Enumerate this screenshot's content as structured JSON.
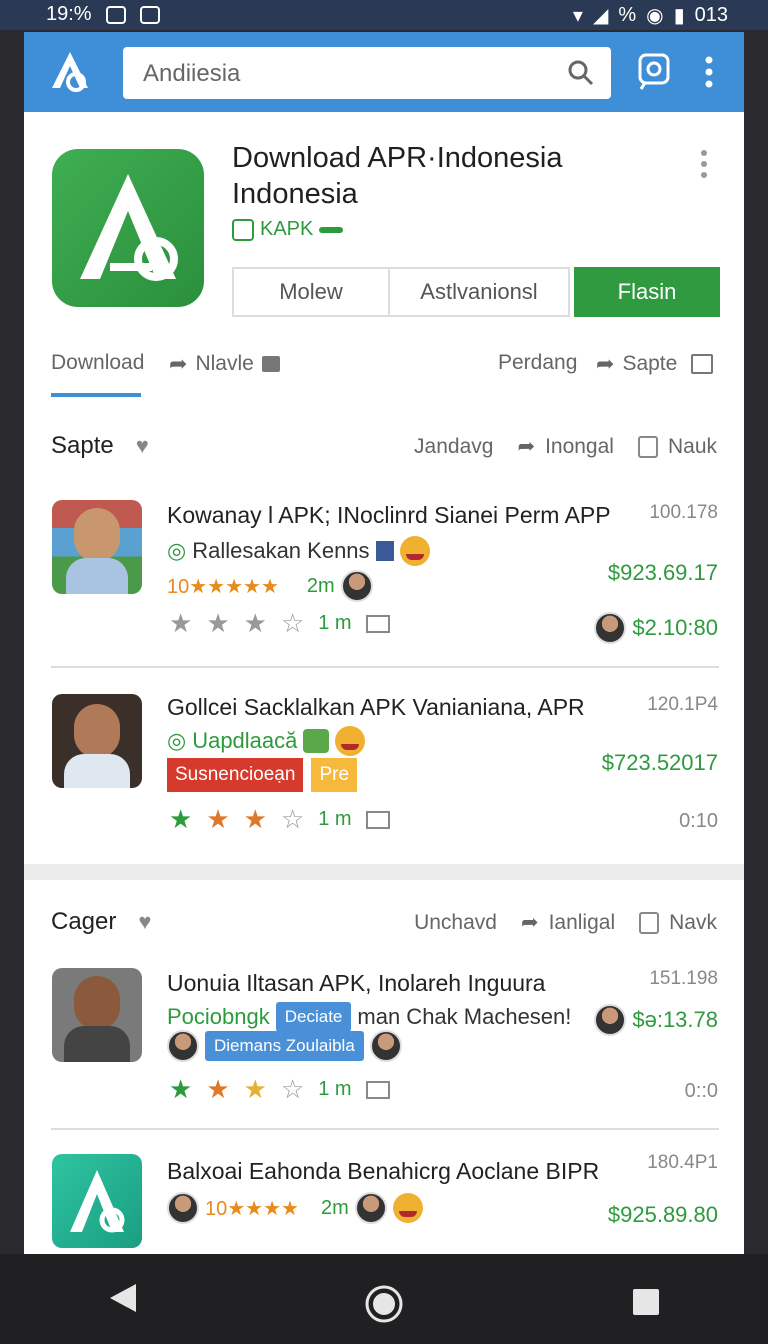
{
  "status": {
    "left_text": "19:%",
    "right_text": "013",
    "pct": "%"
  },
  "search": {
    "value": "Andiiesia"
  },
  "header": {
    "title": "Download APR·Indonesia Indonesia",
    "tag": "KAPK",
    "buttons": [
      "Molew",
      "Astlvanionsl",
      "Flasin"
    ],
    "tabs": {
      "download": "Download",
      "share": "Nlavle",
      "pending": "Perdang",
      "save": "Sapte"
    }
  },
  "section1": {
    "title": "Sapte",
    "actions": [
      "Jandavg",
      "Inongal",
      "Nauk"
    ],
    "items": [
      {
        "title": "Kowanay l APK; INoclinrd Sianei Perm APP",
        "sub": "Rallesakan Kenns",
        "rating_text": "10★★★★★",
        "time": "2m",
        "num": "100.178",
        "price": "$923.69.17",
        "stars_time": "1 m",
        "price2": "$2.10:80"
      },
      {
        "title": "Gollcei Sacklalkan APK Vanianiana, APR",
        "sub": "Uapdlaacă",
        "badge_red": "Susnencioeạn",
        "badge_yellow": "Pre",
        "num": "120.1P4",
        "price": "$723.52017",
        "stars_time": "1 m",
        "right_bottom": "0:10"
      }
    ]
  },
  "section2": {
    "title": "Cager",
    "actions": [
      "Unchavd",
      "Ianligal",
      "Navk"
    ],
    "items": [
      {
        "title": "Uonuia Iltasan APK, Inolareh Inguura",
        "sub_green": "Pociobngk",
        "sub_badge": "Deciate",
        "sub_text": "man Chak Machesen!",
        "tooltip": "Diemans Zoulaibla",
        "num": "151.198",
        "price": "$ə:13.78",
        "stars_time": "1 m",
        "right_bottom": "0::0"
      },
      {
        "title": "Balxoai Eahonda Benahicrg Aoclane BIPR",
        "rating_text": "10★★★★",
        "time": "2m",
        "num": "180.4P1",
        "price": "$925.89.80"
      }
    ]
  },
  "colors": {
    "appbar": "#3e8ed8",
    "green": "#2e9a3e",
    "accent_orange": "#e88a1c"
  }
}
